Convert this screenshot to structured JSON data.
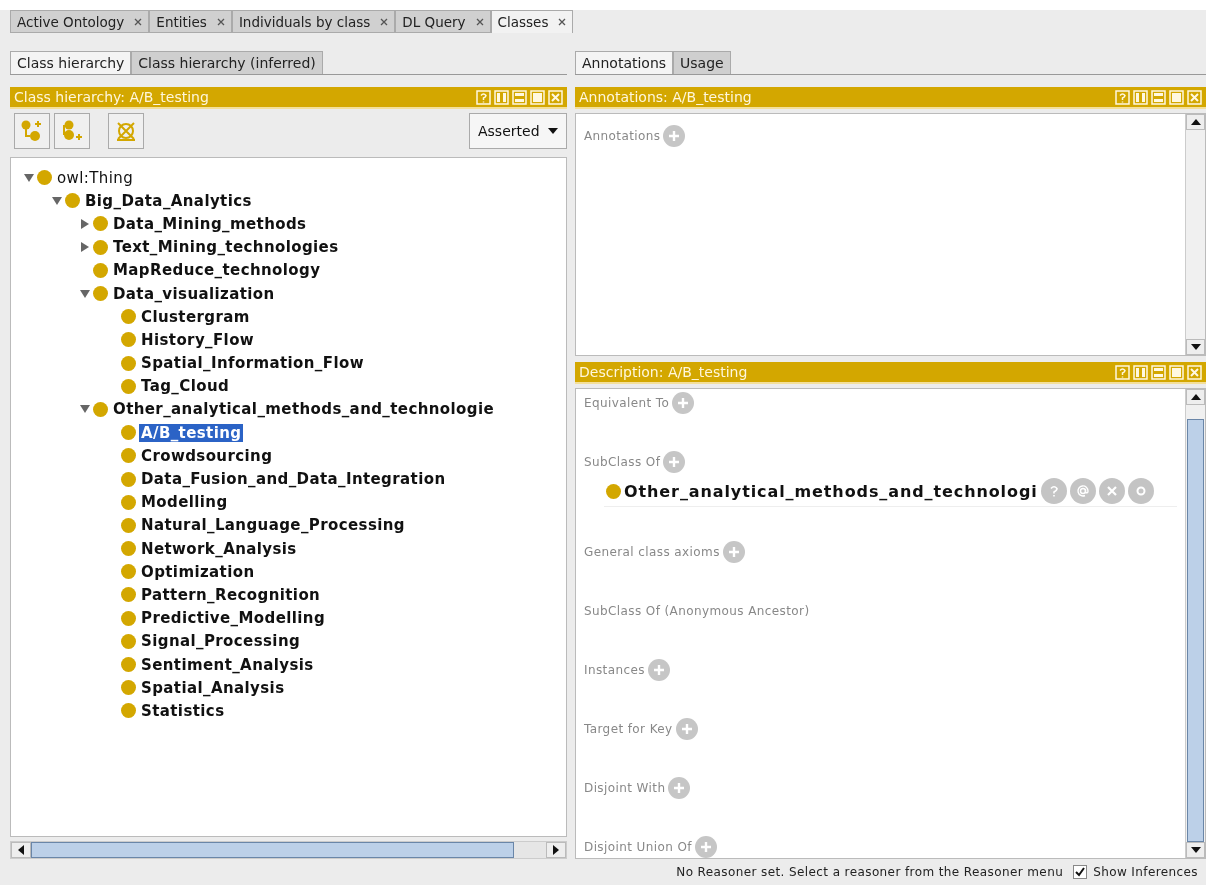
{
  "top_tabs": [
    {
      "label": "Active Ontology",
      "selected": false
    },
    {
      "label": "Entities",
      "selected": false
    },
    {
      "label": "Individuals by class",
      "selected": false
    },
    {
      "label": "DL Query",
      "selected": false
    },
    {
      "label": "Classes",
      "selected": true
    }
  ],
  "left": {
    "tabs": [
      {
        "label": "Class hierarchy",
        "selected": true
      },
      {
        "label": "Class hierarchy (inferred)",
        "selected": false
      }
    ],
    "header": "Class hierarchy: A/B_testing",
    "dropdown": "Asserted",
    "tree": [
      {
        "label": "owl:Thing",
        "expanded": true,
        "selected": false,
        "children": [
          {
            "label": "Big_Data_Analytics",
            "expanded": true,
            "selected": false,
            "children": [
              {
                "label": "Data_Mining_methods",
                "expanded": false,
                "selected": false
              },
              {
                "label": "Text_Mining_technologies",
                "expanded": false,
                "selected": false
              },
              {
                "label": "MapReduce_technology",
                "selected": false
              },
              {
                "label": "Data_visualization",
                "expanded": true,
                "selected": false,
                "children": [
                  {
                    "label": "Clustergram",
                    "selected": false
                  },
                  {
                    "label": "History_Flow",
                    "selected": false
                  },
                  {
                    "label": "Spatial_Information_Flow",
                    "selected": false
                  },
                  {
                    "label": "Tag_Cloud",
                    "selected": false
                  }
                ]
              },
              {
                "label": "Other_analytical_methods_and_technologie",
                "expanded": true,
                "selected": false,
                "children": [
                  {
                    "label": "A/B_testing",
                    "selected": true
                  },
                  {
                    "label": "Crowdsourcing",
                    "selected": false
                  },
                  {
                    "label": "Data_Fusion_and_Data_Integration",
                    "selected": false
                  },
                  {
                    "label": "Modelling",
                    "selected": false
                  },
                  {
                    "label": "Natural_Language_Processing",
                    "selected": false
                  },
                  {
                    "label": "Network_Analysis",
                    "selected": false
                  },
                  {
                    "label": "Optimization",
                    "selected": false
                  },
                  {
                    "label": "Pattern_Recognition",
                    "selected": false
                  },
                  {
                    "label": "Predictive_Modelling",
                    "selected": false
                  },
                  {
                    "label": "Signal_Processing",
                    "selected": false
                  },
                  {
                    "label": "Sentiment_Analysis",
                    "selected": false
                  },
                  {
                    "label": "Spatial_Analysis",
                    "selected": false
                  },
                  {
                    "label": "Statistics",
                    "selected": false
                  }
                ]
              }
            ]
          }
        ]
      }
    ]
  },
  "right": {
    "tabs": [
      {
        "label": "Annotations",
        "selected": true
      },
      {
        "label": "Usage",
        "selected": false
      }
    ],
    "annotations_header": "Annotations: A/B_testing",
    "annotations_label": "Annotations",
    "description_header": "Description: A/B_testing",
    "sections": [
      {
        "label": "Equivalent To",
        "add": true
      },
      {
        "label": "SubClass Of",
        "add": true,
        "entries": [
          "Other_analytical_methods_and_technologi"
        ]
      },
      {
        "label": "General class axioms",
        "add": true
      },
      {
        "label": "SubClass Of (Anonymous Ancestor)",
        "add": false
      },
      {
        "label": "Instances",
        "add": true
      },
      {
        "label": "Target for Key",
        "add": true
      },
      {
        "label": "Disjoint With",
        "add": true
      },
      {
        "label": "Disjoint Union Of",
        "add": true
      }
    ]
  },
  "status": {
    "text": "No Reasoner set. Select a reasoner from the Reasoner menu",
    "checkbox": {
      "label": "Show Inferences",
      "checked": true
    }
  }
}
